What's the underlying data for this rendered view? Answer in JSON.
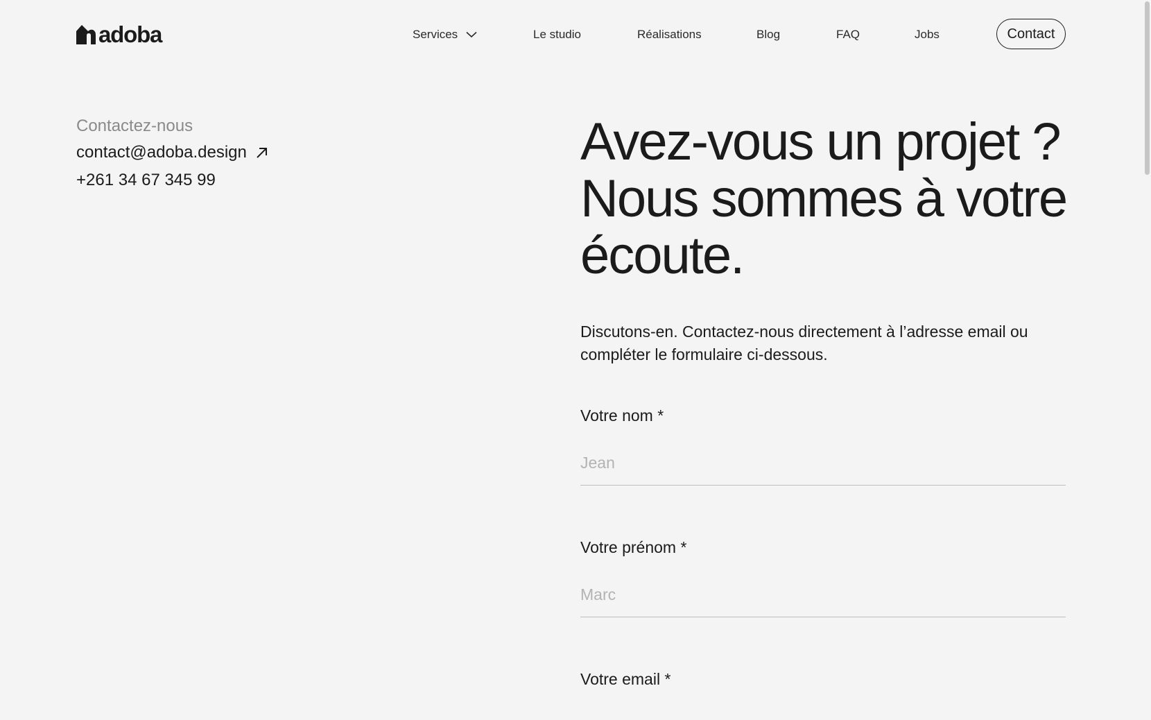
{
  "header": {
    "logo_text": "adoba",
    "nav": [
      {
        "label": "Services",
        "has_dropdown": true
      },
      {
        "label": "Le studio"
      },
      {
        "label": "Réalisations"
      },
      {
        "label": "Blog"
      },
      {
        "label": "FAQ"
      },
      {
        "label": "Jobs"
      }
    ],
    "contact_button": "Contact"
  },
  "contact_info": {
    "label": "Contactez-nous",
    "email": "contact@adoba.design",
    "phone": "+261 34 67 345 99"
  },
  "main": {
    "headline": "Avez-vous un projet ? Nous sommes à votre écoute.",
    "intro": "Discutons-en. Contactez-nous directement à l’adresse email ou compléter le formulaire ci-dessous."
  },
  "form": {
    "fields": [
      {
        "label": "Votre nom *",
        "placeholder": "Jean"
      },
      {
        "label": "Votre prénom *",
        "placeholder": "Marc"
      },
      {
        "label": "Votre email *"
      }
    ]
  },
  "icons": {
    "logo": "house-logo-icon",
    "dropdown": "chevron-down-icon",
    "external": "arrow-up-right-icon"
  },
  "colors": {
    "background": "#f4f4f4",
    "text": "#1b1b1b",
    "muted": "#8a8a8a",
    "placeholder": "#b3b3b3",
    "divider": "#bdbdbd"
  }
}
